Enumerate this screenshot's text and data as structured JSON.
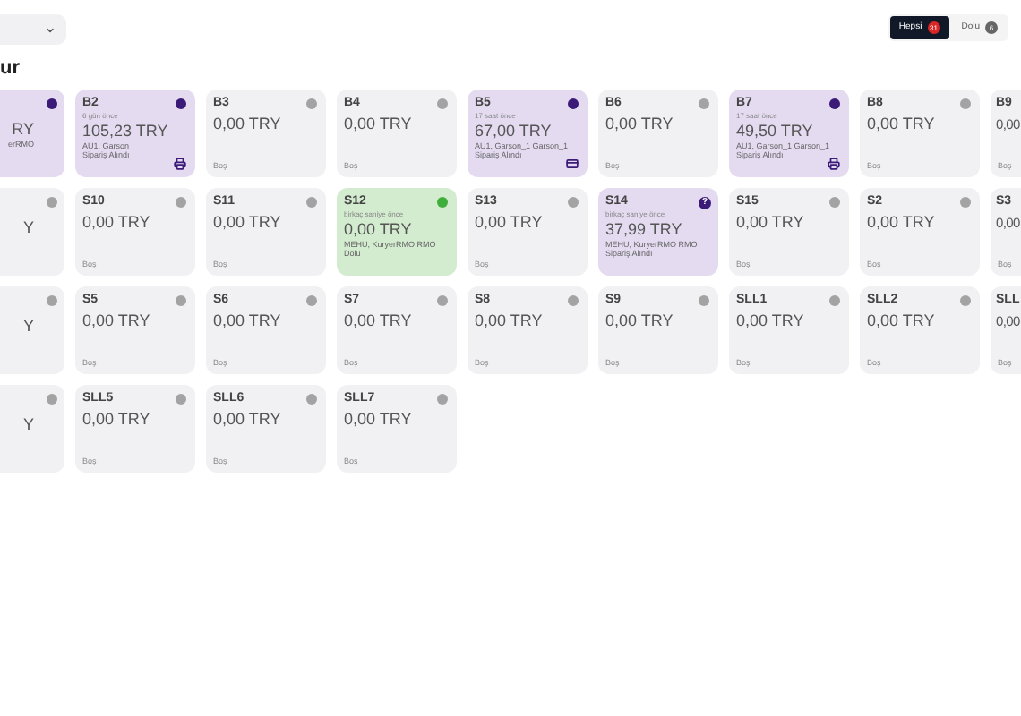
{
  "heading": "ur",
  "filters": [
    {
      "label": "Hepsi",
      "count": "31",
      "selected": true
    },
    {
      "label": "Dolu",
      "count": "6",
      "selected": false
    }
  ],
  "rows": [
    [
      {
        "kind": "occupied",
        "color": "#3b1a78",
        "price": "RY",
        "details": [
          "erRMO"
        ]
      },
      {
        "kind": "occupied",
        "color": "#3b1a78",
        "title": "B2",
        "subtitle": "6 gün önce",
        "price": "105,23 TRY",
        "details": [
          "AU1, Garson",
          "Sipariş Alındı"
        ],
        "action": {
          "kind": "printer"
        }
      },
      {
        "kind": "empty",
        "color": "#a3a3a3",
        "title": "B3",
        "price": "0,00 TRY",
        "footer": "Boş"
      },
      {
        "kind": "empty",
        "color": "#a3a3a3",
        "title": "B4",
        "price": "0,00 TRY",
        "footer": "Boş"
      },
      {
        "kind": "occupied",
        "color": "#3b1a78",
        "title": "B5",
        "subtitle": "17 saat önce",
        "price": "67,00 TRY",
        "details": [
          "AU1, Garson_1 Garson_1",
          "Sipariş Alındı"
        ],
        "action": {
          "kind": "card"
        }
      },
      {
        "kind": "empty",
        "color": "#a3a3a3",
        "title": "B6",
        "price": "0,00 TRY",
        "footer": "Boş"
      },
      {
        "kind": "occupied",
        "color": "#3b1a78",
        "title": "B7",
        "subtitle": "17 saat önce",
        "price": "49,50 TRY",
        "details": [
          "AU1, Garson_1 Garson_1",
          "Sipariş Alındı"
        ],
        "action": {
          "kind": "printer"
        }
      },
      {
        "kind": "empty",
        "color": "#a3a3a3",
        "title": "B8",
        "price": "0,00 TRY",
        "footer": "Boş"
      },
      {
        "kind": "empty",
        "title": "B9",
        "price": "0,00",
        "footer": "Boş"
      }
    ],
    [
      {
        "kind": "empty",
        "color": "#a3a3a3",
        "price": "Y"
      },
      {
        "kind": "empty",
        "color": "#a3a3a3",
        "title": "S10",
        "price": "0,00 TRY",
        "footer": "Boş"
      },
      {
        "kind": "empty",
        "color": "#a3a3a3",
        "title": "S11",
        "price": "0,00 TRY",
        "footer": "Boş"
      },
      {
        "kind": "full",
        "color": "#3fae3a",
        "title": "S12",
        "subtitle": "birkaç saniye önce",
        "price": "0,00 TRY",
        "details": [
          "MEHU, KuryerRMO RMO",
          "Dolu"
        ]
      },
      {
        "kind": "empty",
        "color": "#a3a3a3",
        "title": "S13",
        "price": "0,00 TRY",
        "footer": "Boş"
      },
      {
        "kind": "occupied",
        "color": "#3b1a78",
        "title": "S14",
        "subtitle": "birkaç saniye önce",
        "price": "37,99 TRY",
        "details": [
          "MEHU, KuryerRMO RMO",
          "Sipariş Alındı"
        ],
        "badge": "?"
      },
      {
        "kind": "empty",
        "color": "#a3a3a3",
        "title": "S15",
        "price": "0,00 TRY",
        "footer": "Boş"
      },
      {
        "kind": "empty",
        "color": "#a3a3a3",
        "title": "S2",
        "price": "0,00 TRY",
        "footer": "Boş"
      },
      {
        "kind": "empty",
        "title": "S3",
        "price": "0,00",
        "footer": "Boş"
      }
    ],
    [
      {
        "kind": "empty",
        "color": "#a3a3a3",
        "price": "Y"
      },
      {
        "kind": "empty",
        "color": "#a3a3a3",
        "title": "S5",
        "price": "0,00 TRY",
        "footer": "Boş"
      },
      {
        "kind": "empty",
        "color": "#a3a3a3",
        "title": "S6",
        "price": "0,00 TRY",
        "footer": "Boş"
      },
      {
        "kind": "empty",
        "color": "#a3a3a3",
        "title": "S7",
        "price": "0,00 TRY",
        "footer": "Boş"
      },
      {
        "kind": "empty",
        "color": "#a3a3a3",
        "title": "S8",
        "price": "0,00 TRY",
        "footer": "Boş"
      },
      {
        "kind": "empty",
        "color": "#a3a3a3",
        "title": "S9",
        "price": "0,00 TRY",
        "footer": "Boş"
      },
      {
        "kind": "empty",
        "color": "#a3a3a3",
        "title": "SLL1",
        "price": "0,00 TRY",
        "footer": "Boş"
      },
      {
        "kind": "empty",
        "color": "#a3a3a3",
        "title": "SLL2",
        "price": "0,00 TRY",
        "footer": "Boş"
      },
      {
        "kind": "empty",
        "title": "SLL",
        "price": "0,00",
        "footer": "Boş"
      }
    ],
    [
      {
        "kind": "empty",
        "color": "#a3a3a3",
        "price": "Y"
      },
      {
        "kind": "empty",
        "color": "#a3a3a3",
        "title": "SLL5",
        "price": "0,00 TRY",
        "footer": "Boş"
      },
      {
        "kind": "empty",
        "color": "#a3a3a3",
        "title": "SLL6",
        "price": "0,00 TRY",
        "footer": "Boş"
      },
      {
        "kind": "empty",
        "color": "#a3a3a3",
        "title": "SLL7",
        "price": "0,00 TRY",
        "footer": "Boş"
      }
    ]
  ]
}
